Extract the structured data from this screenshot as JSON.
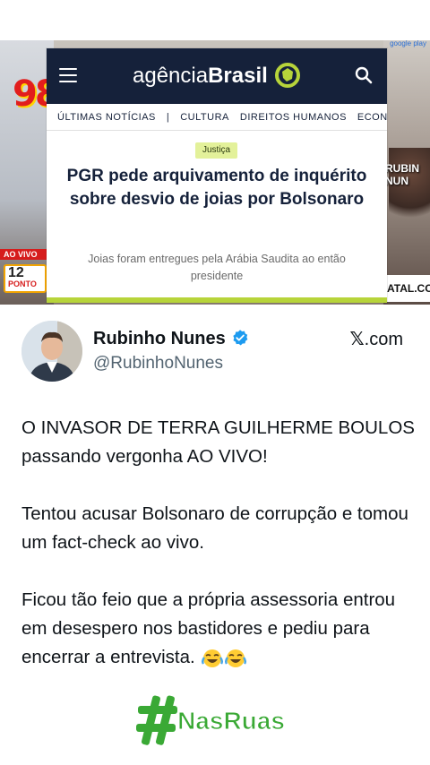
{
  "video": {
    "ao_vivo": "AO VIVO",
    "ponto_badge_num": "12",
    "ponto_badge_text": "PONTO",
    "radio_logo": "98",
    "right_label": "RUBIN NUN",
    "right_strip": "ATAL.COM",
    "top_strip": "google play"
  },
  "news": {
    "brand_light": "agência",
    "brand_bold": "Brasil",
    "nav": [
      "ÚLTIMAS NOTÍCIAS",
      "|",
      "CULTURA",
      "DIREITOS HUMANOS",
      "ECONOMIA"
    ],
    "tag": "Justiça",
    "headline": "PGR pede arquivamento de inquérito sobre desvio de joias por Bolsonaro",
    "subhead": "Joias foram entregues pela Arábia Saudita ao então presidente",
    "colors": {
      "header": "#15213a",
      "accent": "#b7d43a",
      "tag_bg": "#e3f19a"
    }
  },
  "tweet": {
    "name": "Rubinho Nunes",
    "handle": "@RubinhoNunes",
    "source": ".com",
    "paragraphs": [
      "O INVASOR DE TERRA GUILHERME BOULOS passando vergonha AO VIVO!",
      "Tentou acusar Bolsonaro de corrupção e tomou um fact-check ao vivo.",
      "Ficou tão feio que a própria assessoria entrou em desespero nos bastidores e pediu para encerrar a entrevista."
    ],
    "emojis": [
      "face-with-tears-of-joy",
      "face-with-tears-of-joy"
    ],
    "verified_color": "#1d9bf0"
  },
  "footer": {
    "hashtag": "#NasRuas",
    "hashtag_color": "#3aa935"
  }
}
